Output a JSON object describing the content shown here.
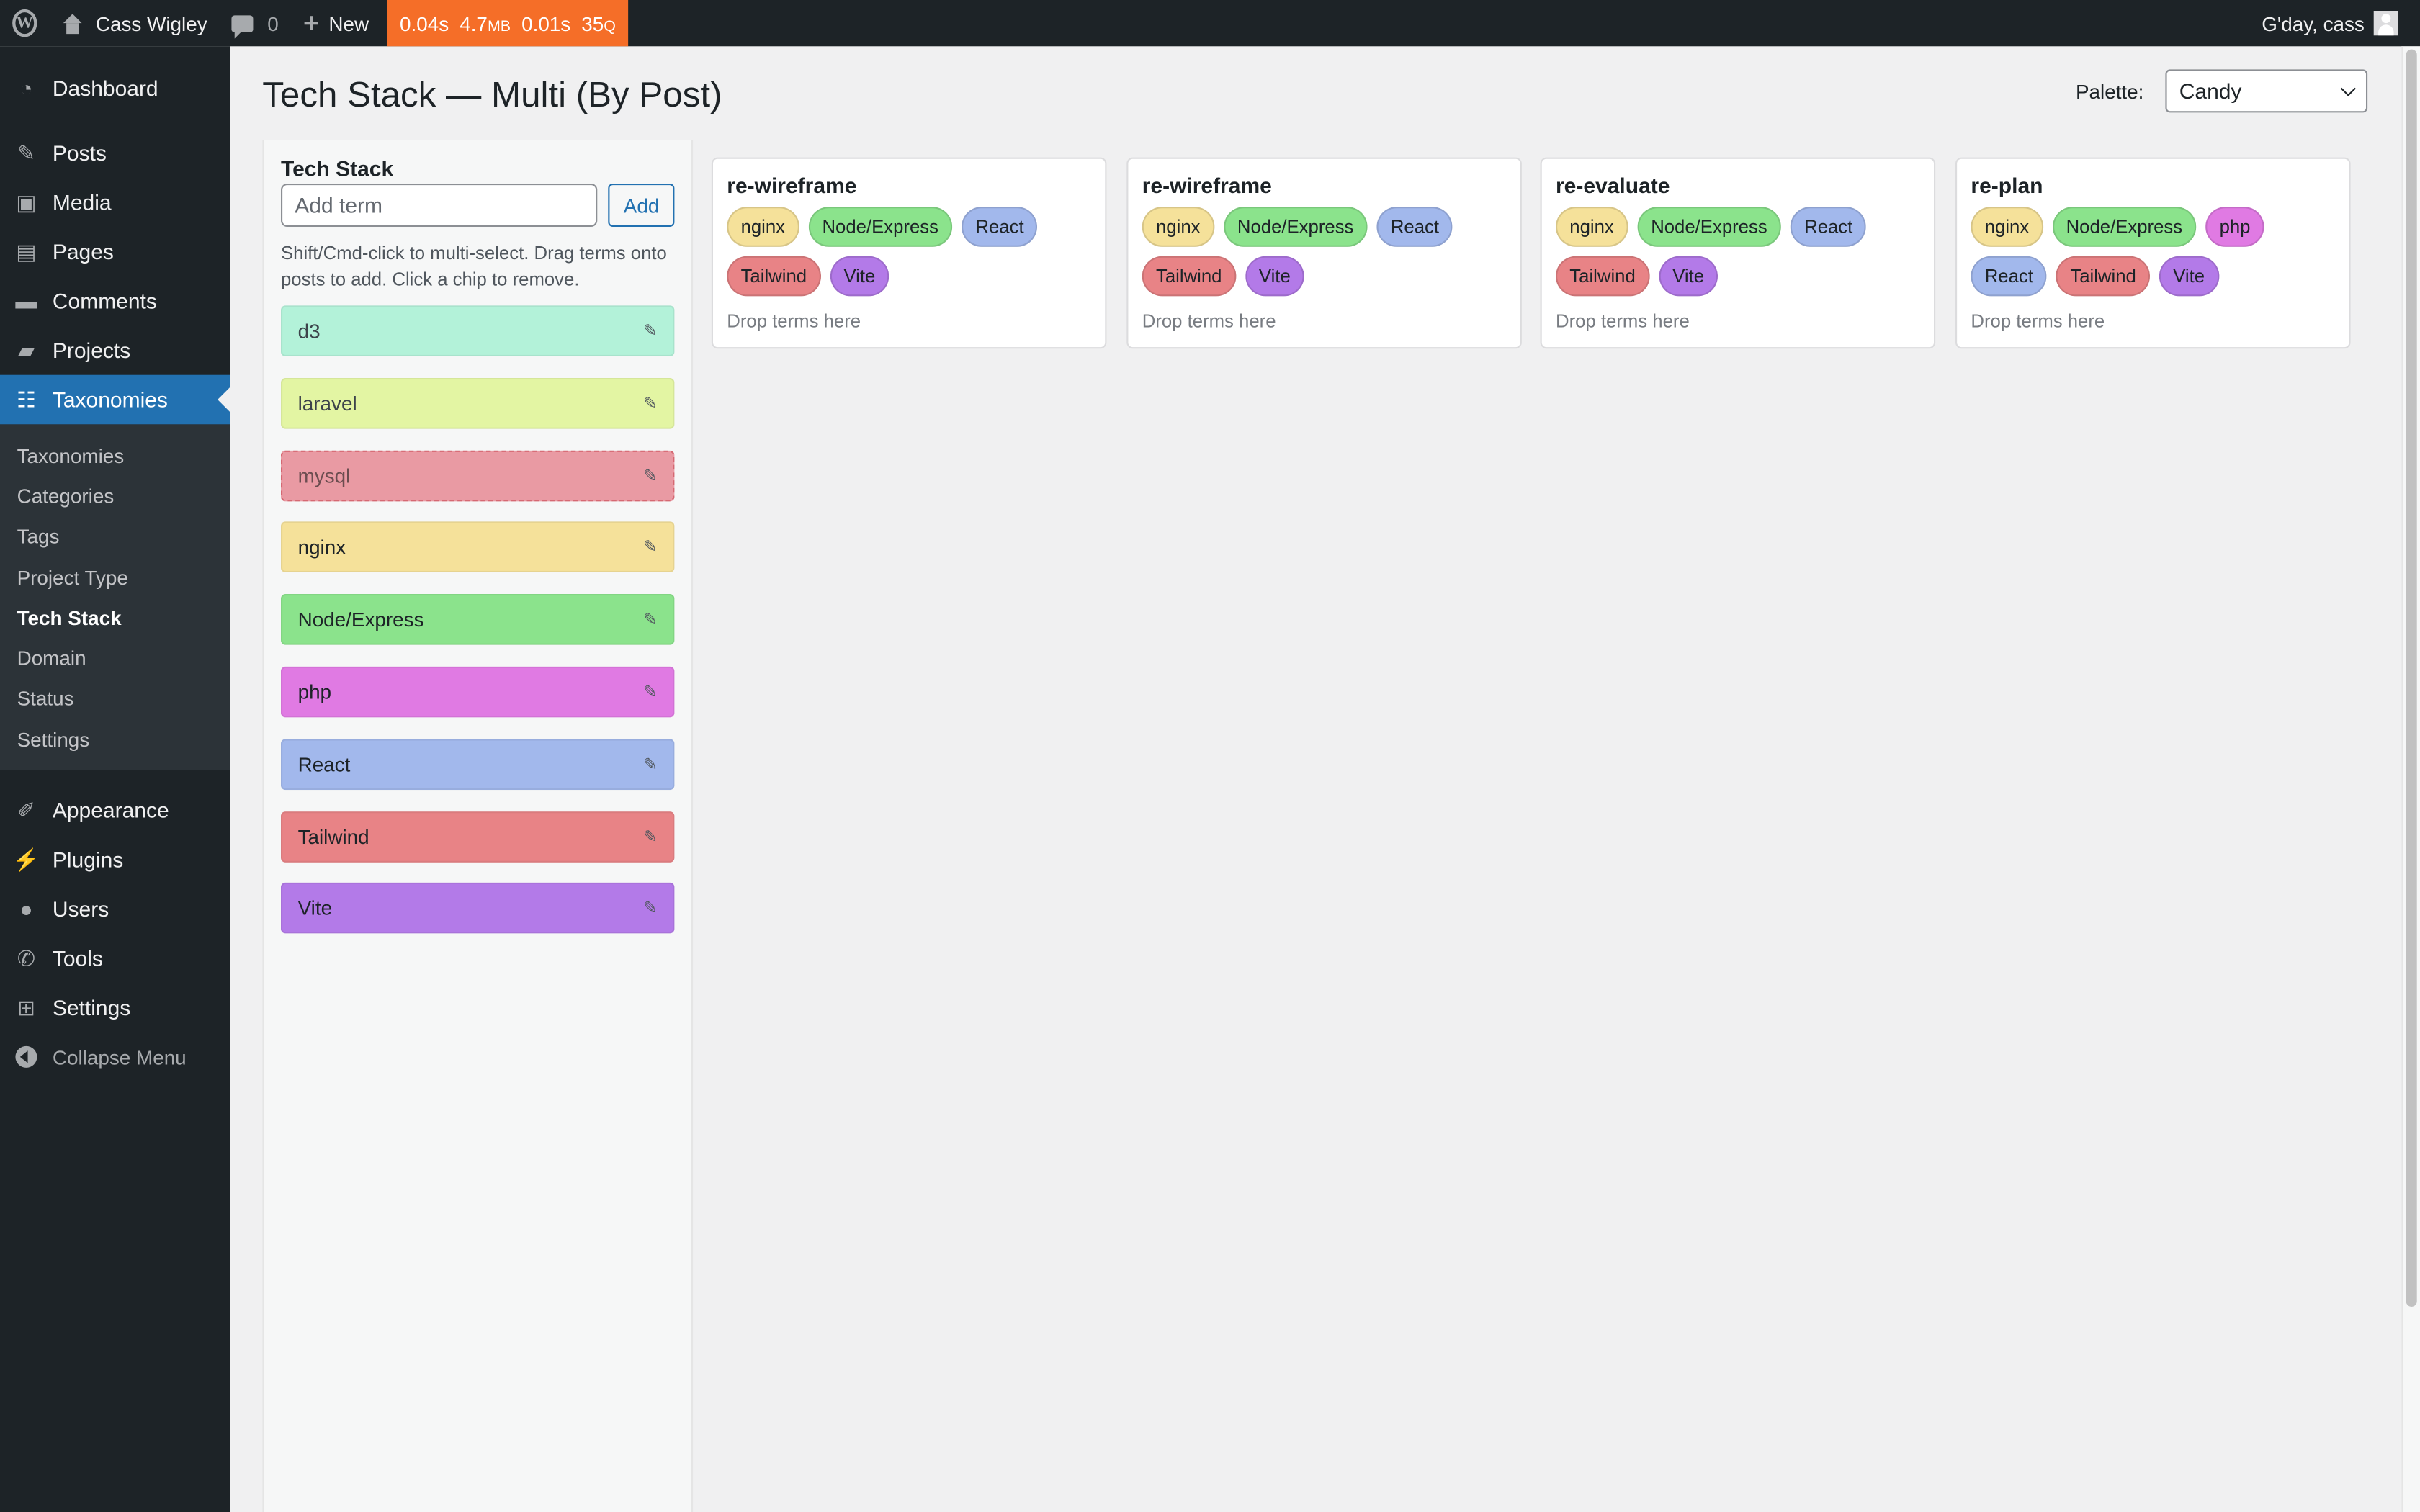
{
  "adminbar": {
    "site_name": "Cass Wigley",
    "comments_count": "0",
    "new_label": "New",
    "qm": {
      "time": "0.04s",
      "memory": "4.7",
      "memory_unit": "MB",
      "db_time": "0.01s",
      "queries": "35",
      "queries_unit": "Q"
    },
    "greeting": "G'day, cass"
  },
  "sidebar": {
    "items_top": [
      {
        "label": "Dashboard",
        "icon": "dashboard-icon"
      }
    ],
    "items_main": [
      {
        "label": "Posts",
        "icon": "pin-icon"
      },
      {
        "label": "Media",
        "icon": "media-icon"
      },
      {
        "label": "Pages",
        "icon": "pages-icon"
      },
      {
        "label": "Comments",
        "icon": "comment-icon"
      },
      {
        "label": "Projects",
        "icon": "folder-icon"
      },
      {
        "label": "Taxonomies",
        "icon": "taxonomy-icon"
      }
    ],
    "submenu": [
      "Taxonomies",
      "Categories",
      "Tags",
      "Project Type",
      "Tech Stack",
      "Domain",
      "Status",
      "Settings"
    ],
    "submenu_current": "Tech Stack",
    "items_bottom": [
      {
        "label": "Appearance",
        "icon": "brush-icon"
      },
      {
        "label": "Plugins",
        "icon": "plugin-icon"
      },
      {
        "label": "Users",
        "icon": "user-icon"
      },
      {
        "label": "Tools",
        "icon": "wrench-icon"
      },
      {
        "label": "Settings",
        "icon": "settings-icon"
      }
    ],
    "collapse_label": "Collapse Menu"
  },
  "page": {
    "title": "Tech Stack — Multi (By Post)",
    "palette_label": "Palette:",
    "palette_value": "Candy"
  },
  "terms_panel": {
    "title": "Tech Stack",
    "add_placeholder": "Add term",
    "add_button": "Add",
    "hint": "Shift/Cmd-click to multi-select. Drag terms onto posts to add. Click a chip to remove.",
    "terms": [
      {
        "name": "d3",
        "color": "#b3f2d9",
        "text_color": "#3c434a"
      },
      {
        "name": "laravel",
        "color": "#e3f5a3",
        "text_color": "#3c434a"
      },
      {
        "name": "mysql",
        "color": "#e99aa3",
        "text_color": "#6c4d50",
        "dragging": true
      },
      {
        "name": "nginx",
        "color": "#f5e19a",
        "text_color": "#1d2327"
      },
      {
        "name": "Node/Express",
        "color": "#8be38c",
        "text_color": "#1d2327"
      },
      {
        "name": "php",
        "color": "#e07ae3",
        "text_color": "#1d2327"
      },
      {
        "name": "React",
        "color": "#a2b8ec",
        "text_color": "#1d2327"
      },
      {
        "name": "Tailwind",
        "color": "#e88386",
        "text_color": "#1d2327"
      },
      {
        "name": "Vite",
        "color": "#b37ae8",
        "text_color": "#1d2327"
      }
    ]
  },
  "posts": [
    {
      "title": "re-wireframe",
      "chips": [
        "nginx",
        "Node/Express",
        "React",
        "Tailwind",
        "Vite"
      ],
      "drop": "Drop terms here"
    },
    {
      "title": "re-wireframe",
      "chips": [
        "nginx",
        "Node/Express",
        "React",
        "Tailwind",
        "Vite"
      ],
      "drop": "Drop terms here"
    },
    {
      "title": "re-evaluate",
      "chips": [
        "nginx",
        "Node/Express",
        "React",
        "Tailwind",
        "Vite"
      ],
      "drop": "Drop terms here"
    },
    {
      "title": "re-plan",
      "chips": [
        "nginx",
        "Node/Express",
        "php",
        "React",
        "Tailwind",
        "Vite"
      ],
      "drop": "Drop terms here"
    }
  ]
}
